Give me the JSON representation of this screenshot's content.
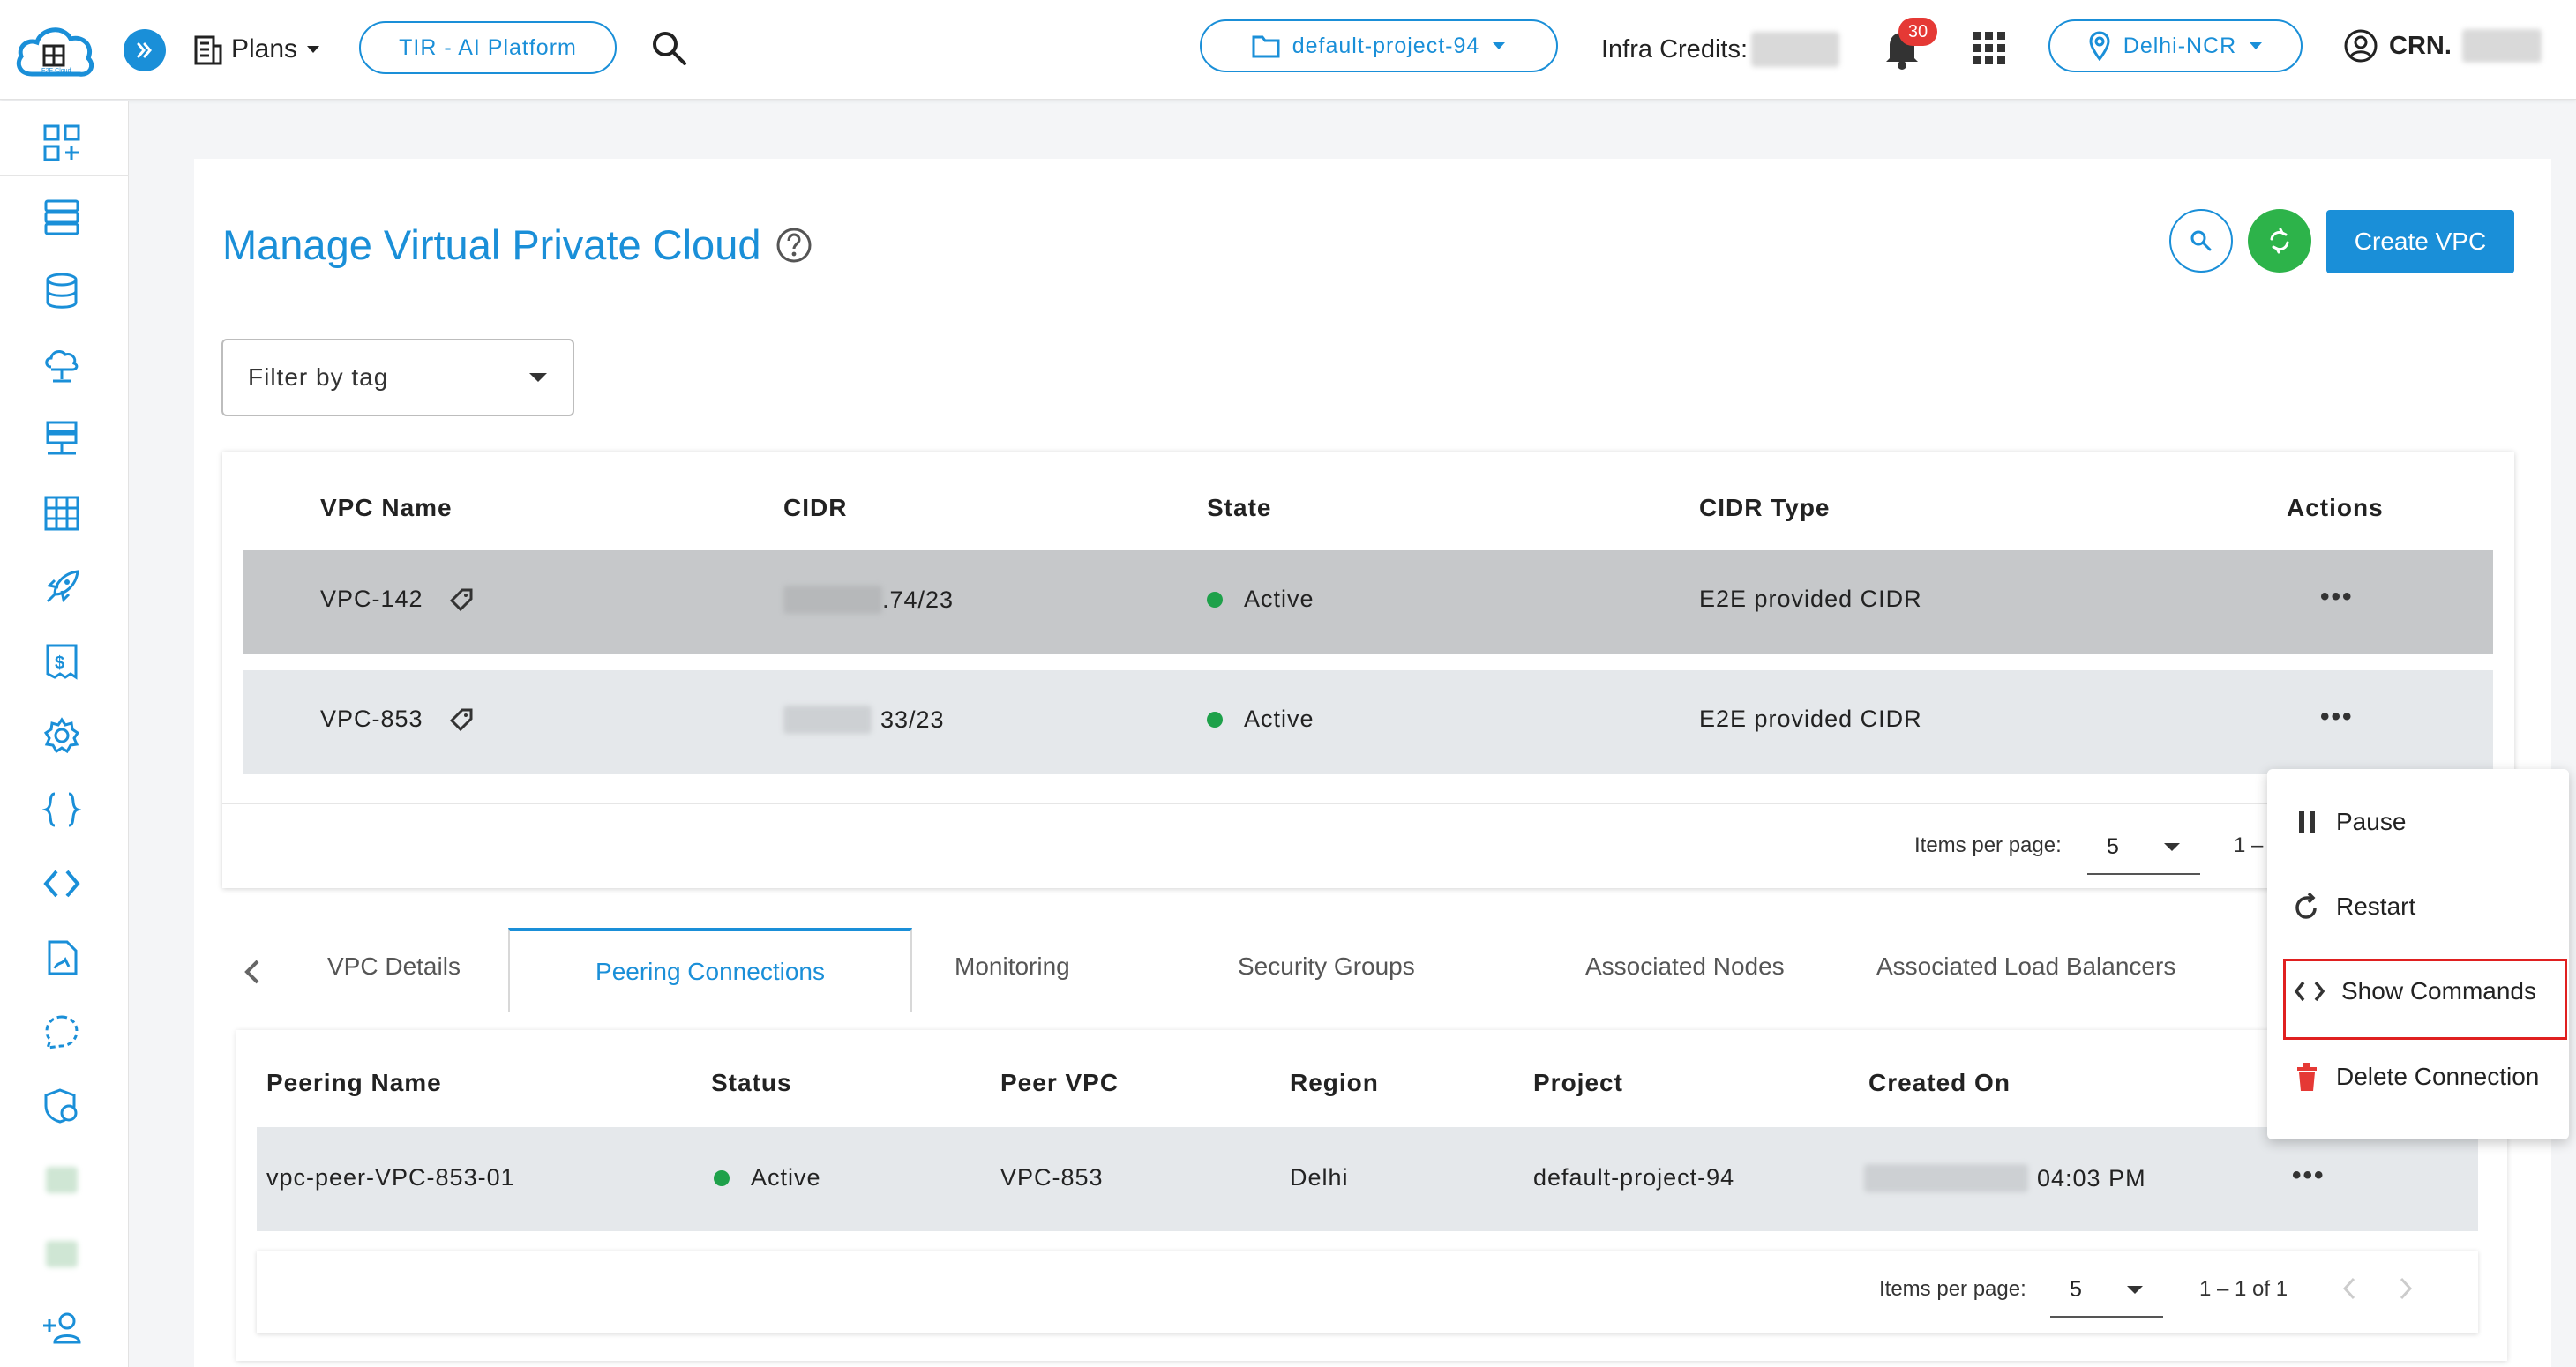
{
  "topbar": {
    "logo_text": "E2E Cloud",
    "plans_label": "Plans",
    "platform_label": "TIR - AI Platform",
    "project_label": "default-project-94",
    "credits_label": "Infra Credits:",
    "notification_count": "30",
    "region_label": "Delhi-NCR",
    "crn_label": "CRN."
  },
  "sidebar": {
    "items": [
      "dashboard-icon",
      "nodes-icon",
      "database-icon",
      "cloud-icon",
      "network-icon",
      "grid-icon",
      "rocket-icon",
      "billing-icon",
      "settings-icon",
      "braces-icon",
      "code-icon",
      "document-icon",
      "support-icon",
      "security-icon",
      "blurred-icon",
      "blurred-icon",
      "add-user-icon"
    ]
  },
  "page": {
    "title": "Manage Virtual Private Cloud",
    "create_button": "Create VPC",
    "filter_placeholder": "Filter by tag"
  },
  "vpc_table": {
    "headers": {
      "name": "VPC Name",
      "cidr": "CIDR",
      "state": "State",
      "cidr_type": "CIDR Type",
      "actions": "Actions"
    },
    "rows": [
      {
        "name": "VPC-142",
        "cidr_suffix": ".74/23",
        "state": "Active",
        "cidr_type": "E2E provided CIDR"
      },
      {
        "name": "VPC-853",
        "cidr_suffix": "33/23",
        "state": "Active",
        "cidr_type": "E2E provided CIDR"
      }
    ],
    "pager": {
      "items_per_page_label": "Items per page:",
      "items_per_page_value": "5",
      "range_text": "1 –"
    }
  },
  "tabs": {
    "vpc_details": "VPC Details",
    "peering_connections": "Peering Connections",
    "monitoring": "Monitoring",
    "security_groups": "Security Groups",
    "associated_nodes": "Associated Nodes",
    "associated_load_balancers": "Associated Load Balancers"
  },
  "peering_table": {
    "headers": {
      "name": "Peering Name",
      "status": "Status",
      "peer_vpc": "Peer VPC",
      "region": "Region",
      "project": "Project",
      "created_on": "Created On"
    },
    "rows": [
      {
        "name": "vpc-peer-VPC-853-01",
        "status": "Active",
        "peer_vpc": "VPC-853",
        "region": "Delhi",
        "project": "default-project-94",
        "created_time": "04:03 PM"
      }
    ],
    "pager": {
      "items_per_page_label": "Items per page:",
      "items_per_page_value": "5",
      "range_text": "1 – 1 of 1"
    }
  },
  "action_menu": {
    "pause": "Pause",
    "restart": "Restart",
    "show_commands": "Show Commands",
    "delete_connection": "Delete Connection"
  },
  "colors": {
    "accent": "#1a8fd8",
    "success": "#2db34a",
    "status_active": "#1ea14a",
    "danger": "#e53935",
    "highlight_box": "#e02020",
    "selected_row": "#c6c8ca",
    "row_bg": "#e5e8eb"
  }
}
